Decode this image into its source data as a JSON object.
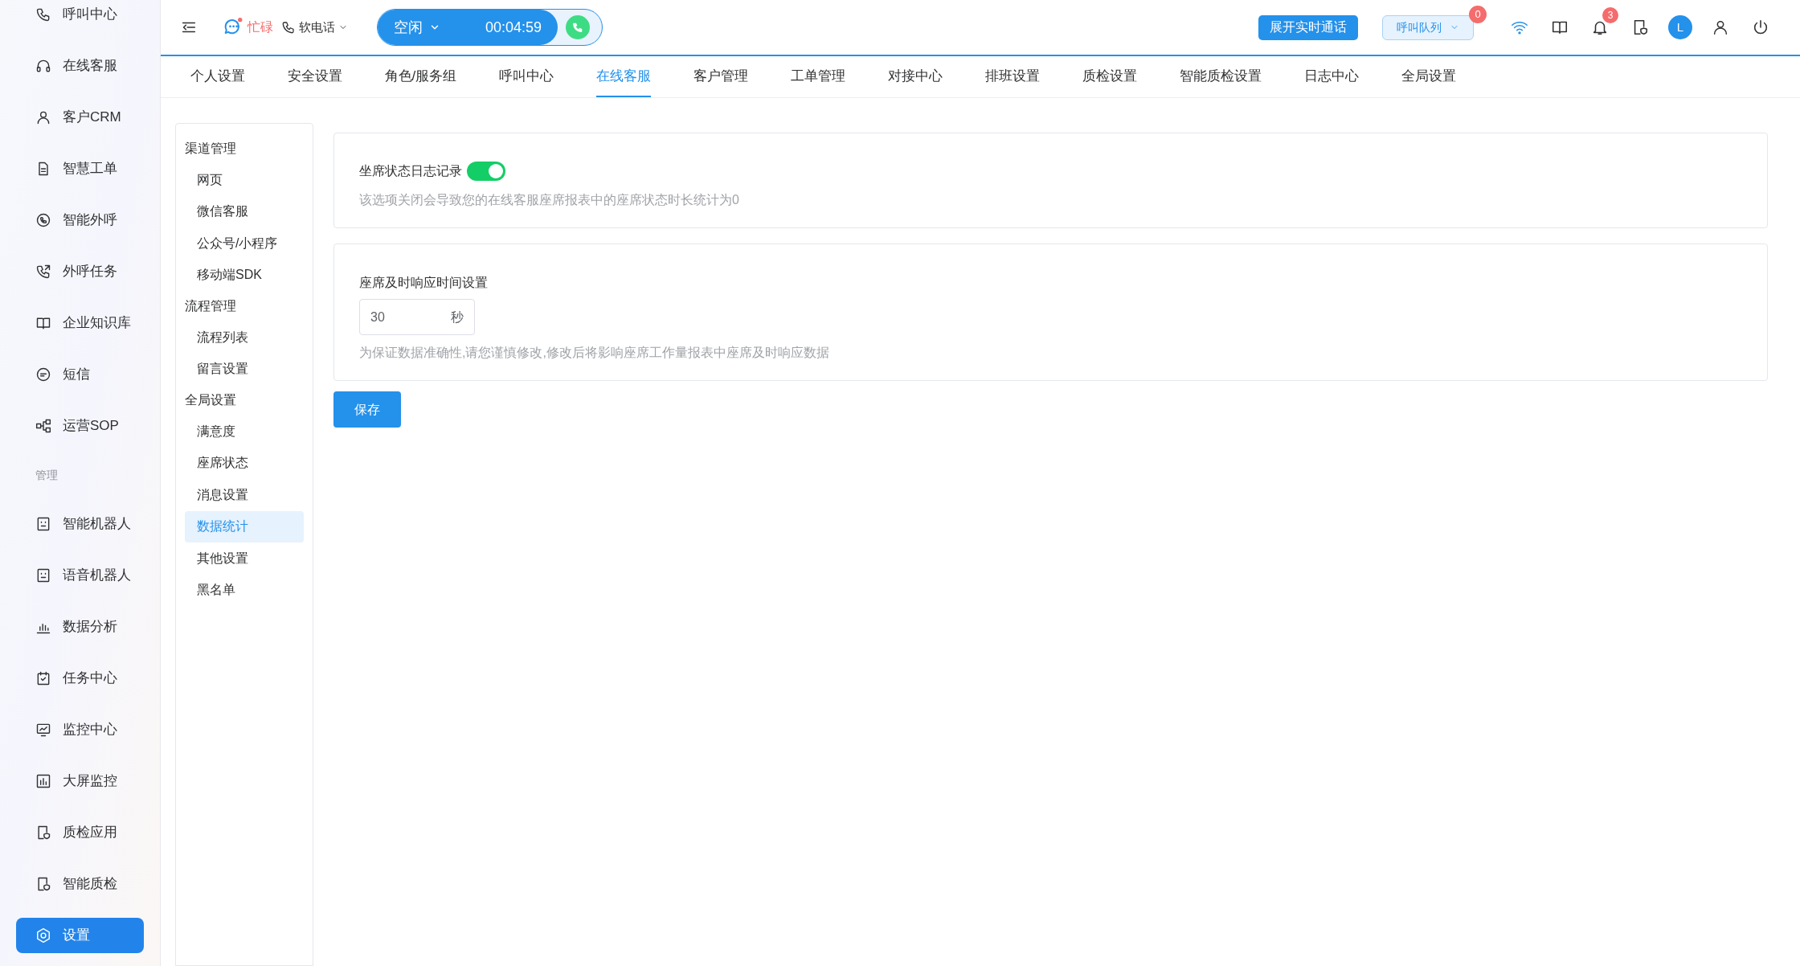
{
  "sidebar": {
    "items": [
      {
        "kind": "link",
        "label": "呼叫中心",
        "selected": false
      },
      {
        "kind": "link",
        "label": "在线客服",
        "selected": false
      },
      {
        "kind": "link",
        "label": "客户CRM",
        "selected": false
      },
      {
        "kind": "link",
        "label": "智慧工单",
        "selected": false
      },
      {
        "kind": "link",
        "label": "智能外呼",
        "selected": false
      },
      {
        "kind": "link",
        "label": "外呼任务",
        "selected": false
      },
      {
        "kind": "link",
        "label": "企业知识库",
        "selected": false
      },
      {
        "kind": "link",
        "label": "短信",
        "selected": false
      },
      {
        "kind": "link",
        "label": "运营SOP",
        "selected": false
      },
      {
        "kind": "section",
        "label": "管理"
      },
      {
        "kind": "link",
        "label": "智能机器人",
        "selected": false
      },
      {
        "kind": "link",
        "label": "语音机器人",
        "selected": false
      },
      {
        "kind": "link",
        "label": "数据分析",
        "selected": false
      },
      {
        "kind": "link",
        "label": "任务中心",
        "selected": false
      },
      {
        "kind": "link",
        "label": "监控中心",
        "selected": false
      },
      {
        "kind": "link",
        "label": "大屏监控",
        "selected": false
      },
      {
        "kind": "link",
        "label": "质检应用",
        "selected": false
      },
      {
        "kind": "link",
        "label": "智能质检",
        "selected": false
      },
      {
        "kind": "link",
        "label": "设置",
        "selected": true
      }
    ]
  },
  "topbar": {
    "status_label": "忙碌",
    "phone_label": "软电话",
    "agent_state": "空闲",
    "timer": "00:04:59",
    "live_call_button": "展开实时通话",
    "queue_dropdown": "呼叫队列",
    "queue_badge": "0",
    "notifications_badge": "3",
    "avatar_initial": "L"
  },
  "tabs": [
    {
      "label": "个人设置",
      "selected": false
    },
    {
      "label": "安全设置",
      "selected": false
    },
    {
      "label": "角色/服务组",
      "selected": false
    },
    {
      "label": "呼叫中心",
      "selected": false
    },
    {
      "label": "在线客服",
      "selected": true
    },
    {
      "label": "客户管理",
      "selected": false
    },
    {
      "label": "工单管理",
      "selected": false
    },
    {
      "label": "对接中心",
      "selected": false
    },
    {
      "label": "排班设置",
      "selected": false
    },
    {
      "label": "质检设置",
      "selected": false
    },
    {
      "label": "智能质检设置",
      "selected": false
    },
    {
      "label": "日志中心",
      "selected": false
    },
    {
      "label": "全局设置",
      "selected": false
    }
  ],
  "submenu": {
    "groups": [
      {
        "label": "渠道管理",
        "children": [
          {
            "label": "网页",
            "selected": false
          },
          {
            "label": "微信客服",
            "selected": false
          },
          {
            "label": "公众号/小程序",
            "selected": false
          },
          {
            "label": "移动端SDK",
            "selected": false
          }
        ]
      },
      {
        "label": "流程管理",
        "children": [
          {
            "label": "流程列表",
            "selected": false
          },
          {
            "label": "留言设置",
            "selected": false
          }
        ]
      },
      {
        "label": "全局设置",
        "children": [
          {
            "label": "满意度",
            "selected": false
          },
          {
            "label": "座席状态",
            "selected": false
          },
          {
            "label": "消息设置",
            "selected": false
          },
          {
            "label": "数据统计",
            "selected": true
          },
          {
            "label": "其他设置",
            "selected": false
          },
          {
            "label": "黑名单",
            "selected": false
          }
        ]
      }
    ]
  },
  "settings": [
    {
      "kind": "toggle",
      "label": "坐席状态日志记录",
      "on": true,
      "hint": "该选项关闭会导致您的在线客服座席报表中的座席状态时长统计为0"
    },
    {
      "kind": "number",
      "label": "座席及时响应时间设置",
      "value": "30",
      "unit": "秒",
      "hint": "为保证数据准确性,请您谨慎修改,修改后将影响座席工作量报表中座席及时响应数据"
    }
  ],
  "save_button": "保存"
}
